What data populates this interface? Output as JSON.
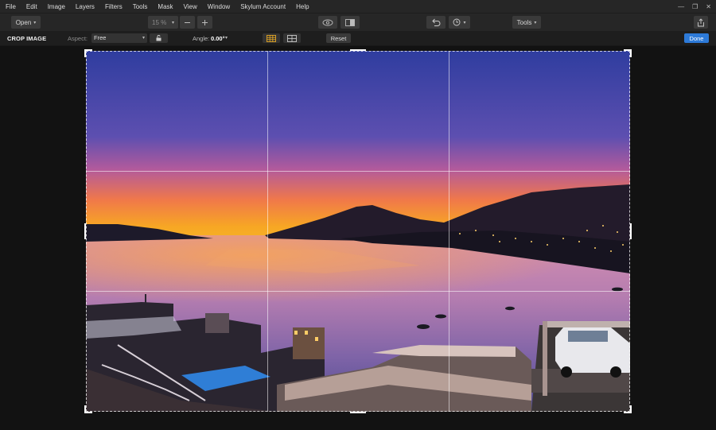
{
  "menubar": {
    "items": [
      {
        "label": "File"
      },
      {
        "label": "Edit"
      },
      {
        "label": "Image"
      },
      {
        "label": "Layers"
      },
      {
        "label": "Filters"
      },
      {
        "label": "Tools"
      },
      {
        "label": "Mask"
      },
      {
        "label": "View"
      },
      {
        "label": "Window"
      },
      {
        "label": "Skylum Account"
      },
      {
        "label": "Help"
      }
    ],
    "window_controls": {
      "minimize": "—",
      "restore": "❐",
      "close": "✕"
    }
  },
  "toolbar": {
    "open_label": "Open",
    "zoom_value": "15 %",
    "zoom_out_icon": "minus-icon",
    "zoom_in_icon": "plus-icon",
    "preview_icon": "eye-icon",
    "compare_icon": "split-view-icon",
    "undo_icon": "undo-icon",
    "history_icon": "clock-icon",
    "tools_label": "Tools",
    "share_icon": "share-icon"
  },
  "options": {
    "title": "CROP IMAGE",
    "aspect_label": "Aspect:",
    "aspect_value": "Free",
    "lock_icon": "unlock-icon",
    "angle_label": "Angle:",
    "angle_value": "0.00°",
    "grid_thirds_icon": "grid-thirds-icon",
    "grid_golden_icon": "grid-quarters-icon",
    "reset_label": "Reset",
    "done_label": "Done",
    "done_color": "#2d7ad8"
  },
  "canvas": {
    "photo_description_icon": "photo-image",
    "colors": {
      "sky_top": "#3a4aa8",
      "sky_mid": "#7b5bb5",
      "horizon": "#f5a020",
      "water": "#b67fb3"
    }
  }
}
